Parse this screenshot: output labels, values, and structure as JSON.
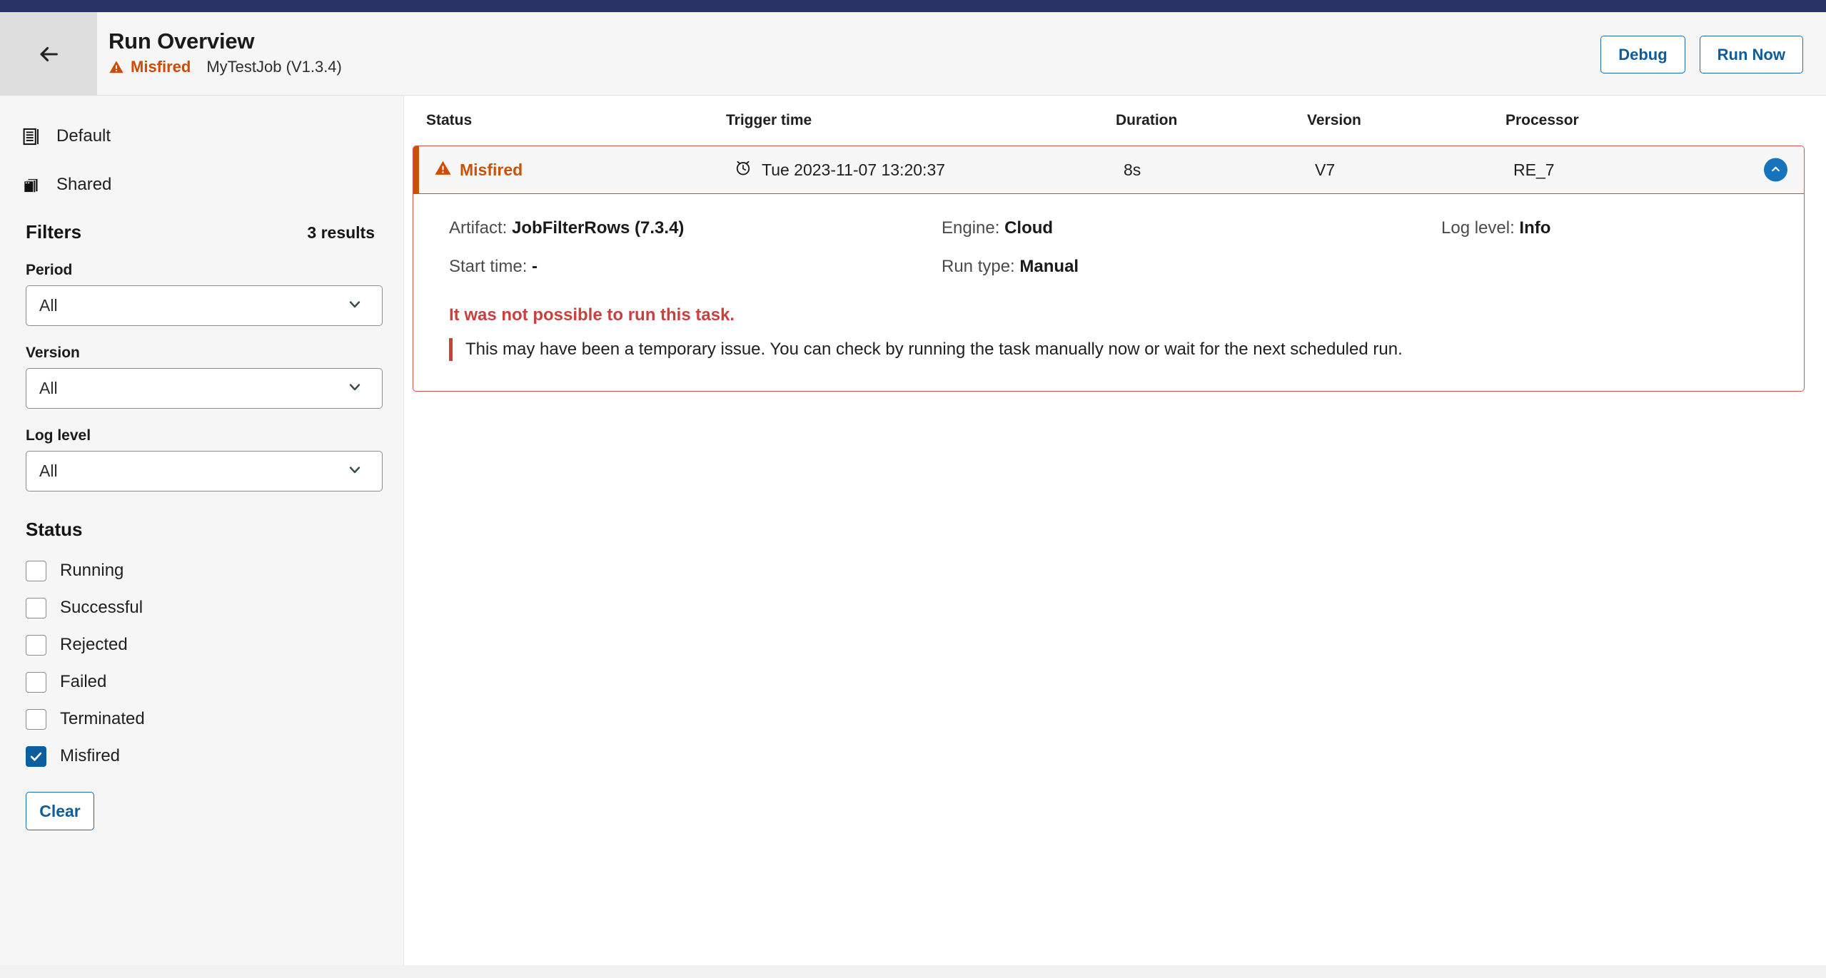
{
  "header": {
    "back_icon": "arrow-left-icon",
    "title": "Run Overview",
    "status_icon": "warning-triangle-icon",
    "status": "Misfired",
    "job": "MyTestJob (V1.3.4)",
    "debug_label": "Debug",
    "run_now_label": "Run Now"
  },
  "sidebar": {
    "nav": [
      {
        "label": "Default",
        "icon": "list-document-icon"
      },
      {
        "label": "Shared",
        "icon": "stacked-layers-icon"
      }
    ],
    "filters_title": "Filters",
    "results_count": "3 results",
    "fields": [
      {
        "label": "Period",
        "value": "All",
        "options": [
          "All"
        ]
      },
      {
        "label": "Version",
        "value": "All",
        "options": [
          "All"
        ]
      },
      {
        "label": "Log level",
        "value": "All",
        "options": [
          "All"
        ]
      }
    ],
    "status_title": "Status",
    "statuses": [
      {
        "label": "Running",
        "checked": false
      },
      {
        "label": "Successful",
        "checked": false
      },
      {
        "label": "Rejected",
        "checked": false
      },
      {
        "label": "Failed",
        "checked": false
      },
      {
        "label": "Terminated",
        "checked": false
      },
      {
        "label": "Misfired",
        "checked": true
      }
    ],
    "clear_label": "Clear"
  },
  "table": {
    "columns": [
      "Status",
      "Trigger time",
      "Duration",
      "Version",
      "Processor"
    ],
    "rows": [
      {
        "status": "Misfired",
        "status_icon": "warning-triangle-icon",
        "trigger_icon": "alarm-clock-icon",
        "trigger_time": "Tue 2023-11-07 13:20:37",
        "duration": "8s",
        "version": "V7",
        "processor": "RE_7",
        "expanded": true,
        "collapse_icon": "chevron-up-icon",
        "detail": {
          "artifact_label": "Artifact:",
          "artifact_value": "JobFilterRows (7.3.4)",
          "engine_label": "Engine:",
          "engine_value": "Cloud",
          "log_level_label": "Log level:",
          "log_level_value": "Info",
          "start_time_label": "Start time:",
          "start_time_value": "-",
          "run_type_label": "Run type:",
          "run_type_value": "Manual",
          "error_title": "It was not possible to run this task.",
          "error_body": "This may have been a temporary issue. You can check by running the task manually now or wait for the next scheduled run."
        }
      }
    ]
  },
  "colors": {
    "navy": "#2a3365",
    "orange": "#c9520a",
    "red": "#c9413f",
    "blue": "#0f5c9c",
    "checkbox_blue": "#0d5e9e"
  }
}
